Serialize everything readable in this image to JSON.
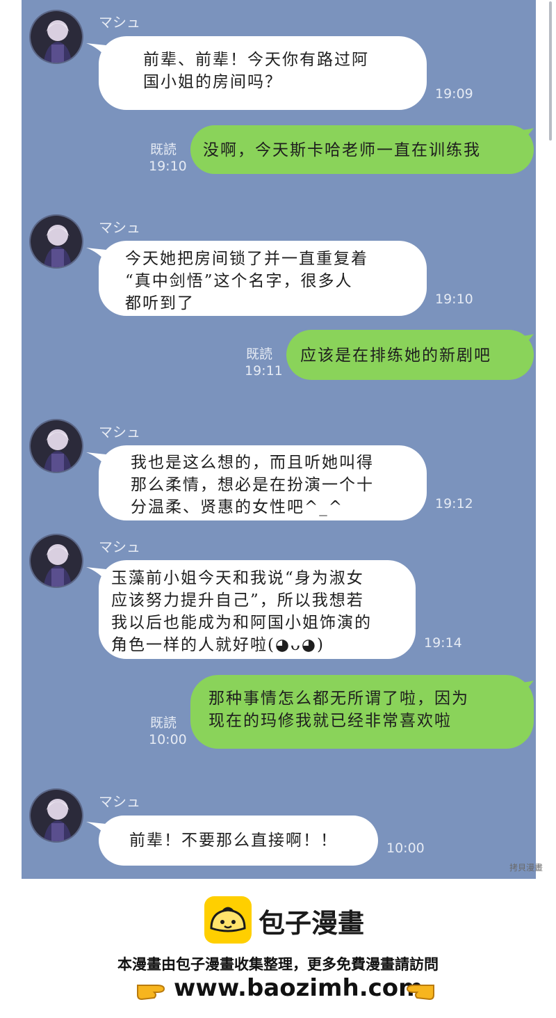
{
  "sender_name": "マシュ",
  "read_label": "既読",
  "messages": [
    {
      "direction": "incoming",
      "lines": [
        "前辈、前辈！今天你有路过阿",
        "国小姐的房间吗？"
      ],
      "time": "19:09"
    },
    {
      "direction": "outgoing",
      "lines": [
        "没啊，今天斯卡哈老师一直在训练我"
      ],
      "time": "19:10",
      "read": "既読"
    },
    {
      "direction": "incoming",
      "lines": [
        "今天她把房间锁了并一直重复着",
        "“真中剑悟”这个名字，很多人",
        "都听到了"
      ],
      "time": "19:10"
    },
    {
      "direction": "outgoing",
      "lines": [
        "应该是在排练她的新剧吧"
      ],
      "time": "19:11",
      "read": "既読"
    },
    {
      "direction": "incoming",
      "lines": [
        "我也是这么想的，而且听她叫得",
        "那么柔情，想必是在扮演一个十",
        "分温柔、贤惠的女性吧^_^"
      ],
      "time": "19:12"
    },
    {
      "direction": "incoming",
      "lines": [
        "玉藻前小姐今天和我说“身为淑女",
        "应该努力提升自己”，所以我想若",
        "我以后也能成为和阿国小姐饰演的",
        "角色一样的人就好啦(◕ᴗ◕)"
      ],
      "time": "19:14"
    },
    {
      "direction": "outgoing",
      "lines": [
        "那种事情怎么都无所谓了啦，因为",
        "现在的玛修我就已经非常喜欢啦"
      ],
      "time": "10:00",
      "read": "既読"
    },
    {
      "direction": "incoming",
      "lines": [
        "前辈！不要那么直接啊！！"
      ],
      "time": "10:00"
    }
  ],
  "watermark": "拷貝漫畫",
  "footer": {
    "brand": "包子漫畫",
    "notice": "本漫畫由包子漫畫收集整理，更多免費漫畫請訪問",
    "url": "www.baozimh.com"
  },
  "colors": {
    "chat_background": "#7b93bd",
    "incoming_bubble": "#ffffff",
    "outgoing_bubble": "#8ad35a",
    "brand_yellow": "#ffcf00"
  }
}
